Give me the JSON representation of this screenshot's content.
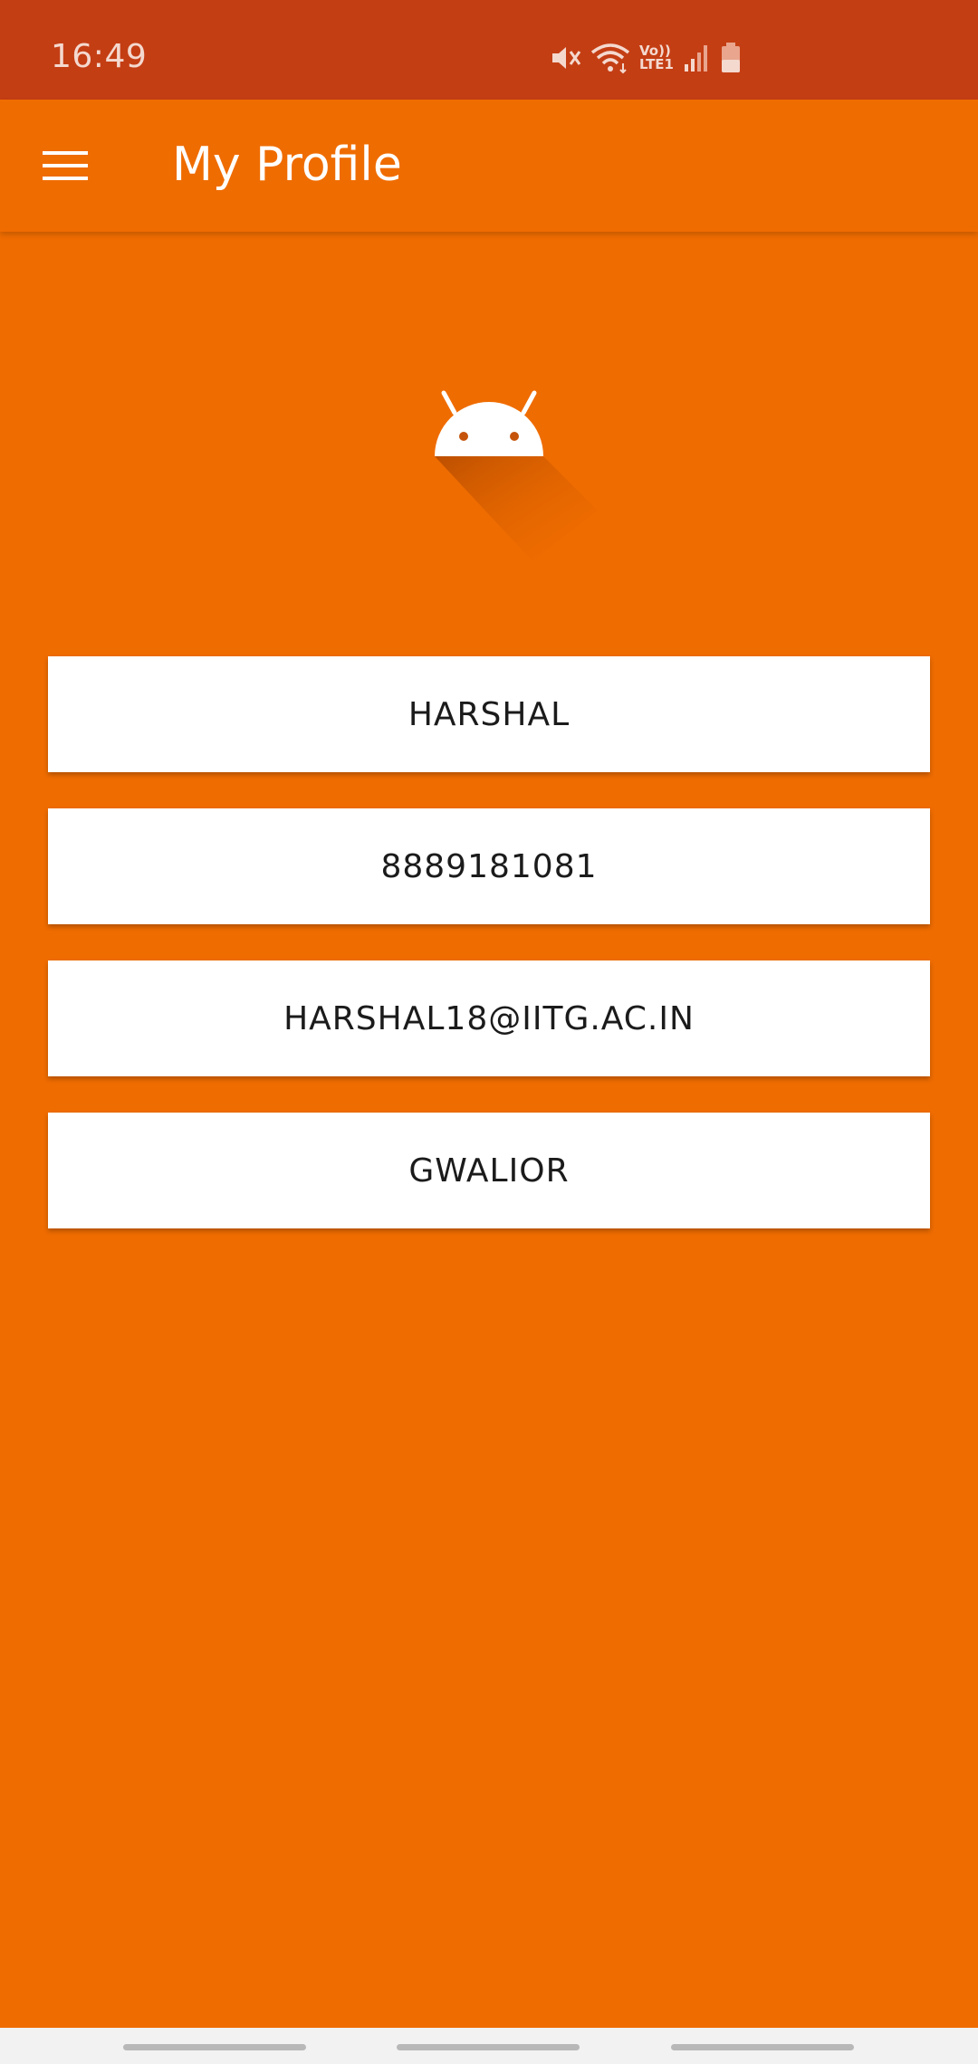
{
  "status_bar": {
    "time": "16:49",
    "icons": [
      "mute-icon",
      "wifi-icon",
      "volte-icon",
      "signal-icon",
      "battery-icon"
    ],
    "volte_label_top": "Vo))",
    "volte_label_bottom": "LTE1"
  },
  "app_bar": {
    "title": "My Profile",
    "menu_icon": "hamburger-menu-icon"
  },
  "profile": {
    "logo_icon": "android-robot-icon",
    "name": "HARSHAL",
    "phone": "8889181081",
    "email": "HARSHAL18@IITG.AC.IN",
    "city": "GWALIOR"
  },
  "colors": {
    "status_bar": "#C43E14",
    "primary": "#EF6C00",
    "card": "#FFFFFF",
    "text": "#1B1B1B"
  },
  "nav_bar": {
    "buttons": [
      "recent-apps-button",
      "home-button",
      "back-button"
    ]
  }
}
